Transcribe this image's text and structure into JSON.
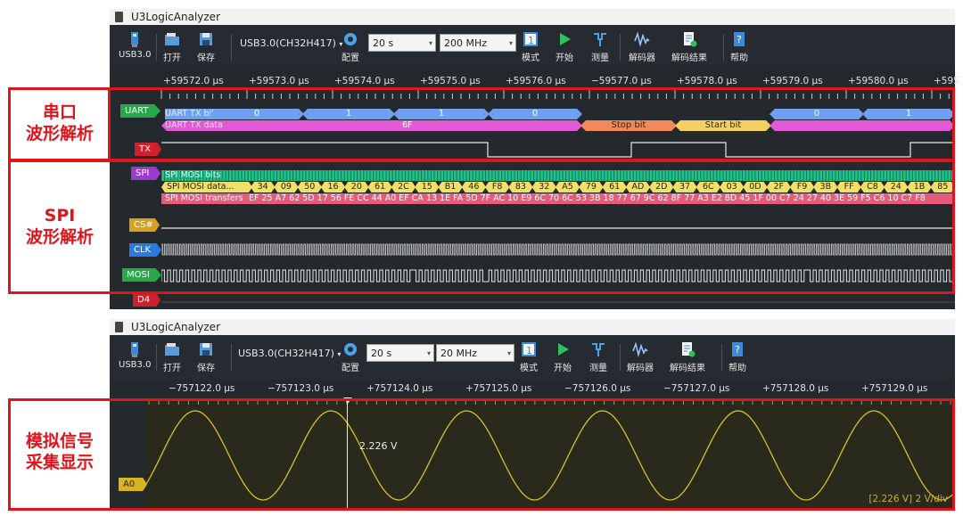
{
  "colors": {
    "annotation_red": "#e0141c",
    "uart_blue": "#6f9ff0",
    "uart_pink": "#e05ad8",
    "stop_orange": "#f08a5d",
    "start_yellow": "#f5d060",
    "spi_green": "#20c08a",
    "analog_yellow": "#d8c020"
  },
  "top": {
    "title": "U3LogicAnalyzer",
    "toolbar": {
      "device_icon_label": "USB3.0",
      "open_label": "打开",
      "save_label": "保存",
      "device_select": "USB3.0(CH32H417)",
      "config_label": "配置",
      "duration_select": "20 s",
      "rate_select": "200 MHz",
      "mode_label": "模式",
      "start_label": "开始",
      "measure_label": "测量",
      "decoder_label": "解码器",
      "decode_result_label": "解码结果",
      "help_label": "帮助"
    },
    "ticks": [
      "+59572.0 μs",
      "+59573.0 μs",
      "+59574.0 μs",
      "+59575.0 μs",
      "+59576.0 μs",
      "−59577.0 μs",
      "+59578.0 μs",
      "+59579.0 μs",
      "+59580.0 μs",
      "+595"
    ],
    "channels": {
      "uart": "UART",
      "tx": "TX",
      "spi": "SPI",
      "cs": "CS#",
      "clk": "CLK",
      "mosi": "MOSI",
      "d4": "D4"
    },
    "uart_rows": {
      "bits_label": "UART TX bits",
      "data_label": "UART TX data",
      "bits": [
        "0",
        "1",
        "1",
        "0",
        "0",
        "1"
      ],
      "data_value": "6F",
      "stop": "Stop bit",
      "start": "Start bit"
    },
    "spi_rows": {
      "bits_label": "SPI MOSI bits",
      "data_label": "SPI MOSI data...",
      "transfers_label": "SPI MOSI transfers",
      "data_bytes": [
        "34",
        "09",
        "50",
        "16",
        "20",
        "61",
        "2C",
        "15",
        "B1",
        "46",
        "F8",
        "83",
        "32",
        "A5",
        "79",
        "61",
        "AD",
        "2D",
        "37",
        "6C",
        "03",
        "0D",
        "2F",
        "F9",
        "3B",
        "FF",
        "C8",
        "24",
        "1B",
        "85"
      ],
      "transfers_text": "EF 25 A7 62 5D 17 56 FE CC 44 A0 EF CA 13 1E FA 5D 7F AC 10 E9 6C 70 6C 53 3B 18 77 67 9C 62 8F 77 A3 E2 8D 45 1F 00 C7 24 27 40 3E 59 F5 C6 10 C7 F8"
    }
  },
  "bottom": {
    "title": "U3LogicAnalyzer",
    "toolbar": {
      "device_icon_label": "USB3.0",
      "open_label": "打开",
      "save_label": "保存",
      "device_select": "USB3.0(CH32H417)",
      "config_label": "配置",
      "duration_select": "20 s",
      "rate_select": "20 MHz",
      "mode_label": "模式",
      "start_label": "开始",
      "measure_label": "测量",
      "decoder_label": "解码器",
      "decode_result_label": "解码结果",
      "help_label": "帮助"
    },
    "ticks": [
      "−757122.0 μs",
      "−757123.0 μs",
      "+757124.0 μs",
      "+757125.0 μs",
      "−757126.0 μs",
      "−757127.0 μs",
      "+757128.0 μs",
      "+757129.0 μs"
    ],
    "channel": "A0",
    "cursor_value": "2.226 V",
    "scale_text": "[2.226 V] 2 V/div"
  },
  "annotations": {
    "uart": [
      "串口",
      "波形解析"
    ],
    "spi": [
      "SPI",
      "波形解析"
    ],
    "analog": [
      "模拟信号",
      "采集显示"
    ]
  }
}
